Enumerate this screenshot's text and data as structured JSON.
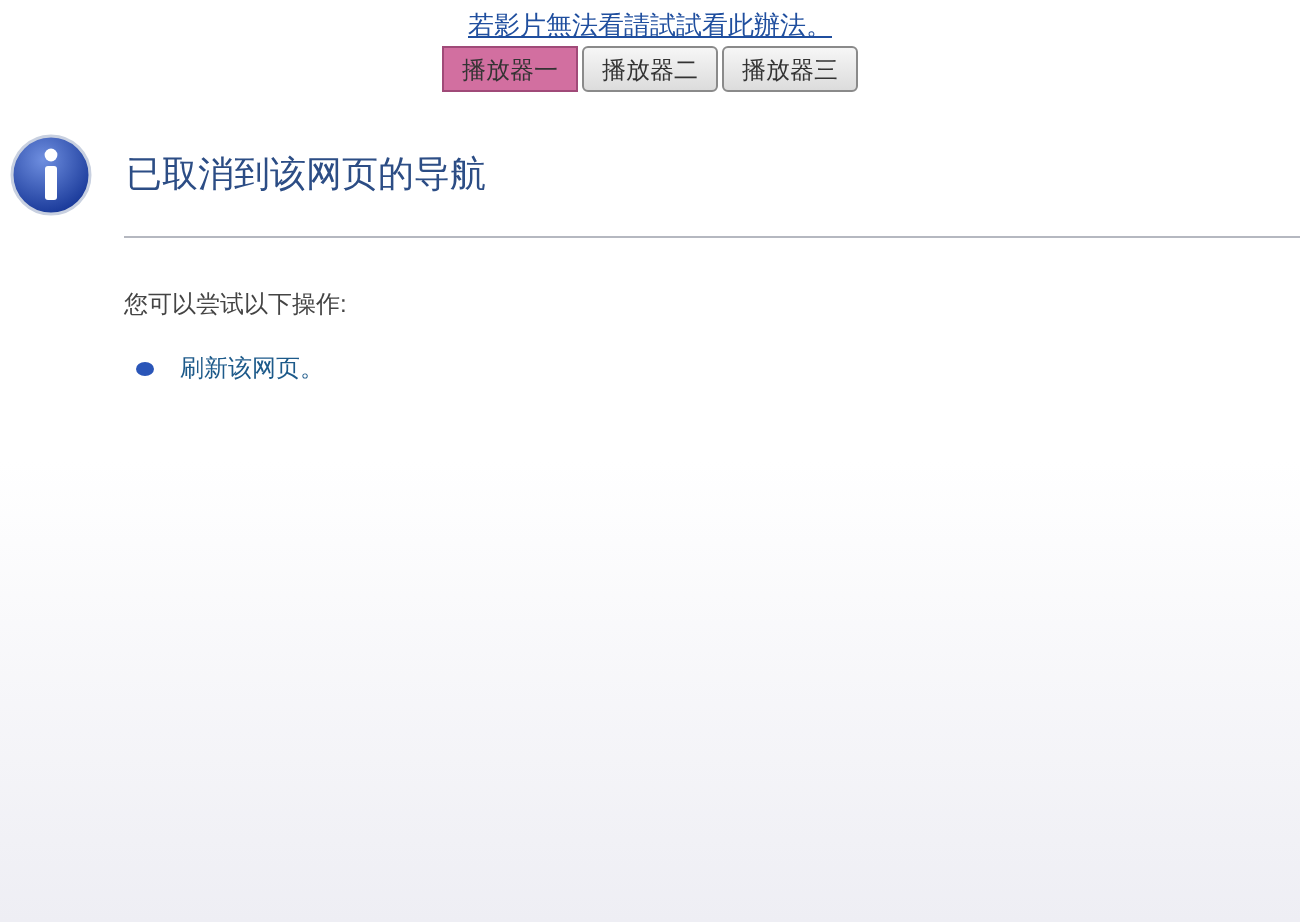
{
  "top_link": "若影片無法看請試試看此辦法。",
  "players": [
    {
      "label": "播放器一",
      "selected": true
    },
    {
      "label": "播放器二",
      "selected": false
    },
    {
      "label": "播放器三",
      "selected": false
    }
  ],
  "heading": "已取消到该网页的导航",
  "subheading": "您可以尝试以下操作:",
  "actions": [
    "刷新该网页。"
  ]
}
